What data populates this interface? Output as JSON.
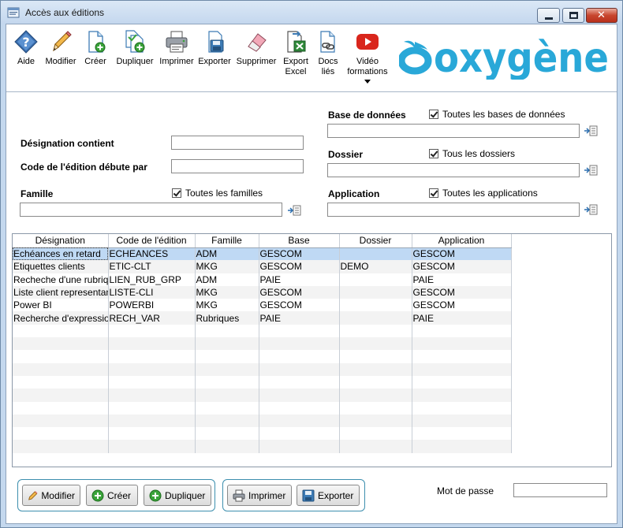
{
  "window": {
    "title": "Accès aux éditions"
  },
  "toolbar": {
    "aide": "Aide",
    "modifier": "Modifier",
    "creer": "Créer",
    "dupliquer": "Dupliquer",
    "imprimer": "Imprimer",
    "exporter": "Exporter",
    "supprimer": "Supprimer",
    "export_excel_1": "Export",
    "export_excel_2": "Excel",
    "docs_lies_1": "Docs",
    "docs_lies_2": "liés",
    "video_1": "Vidéo",
    "video_2": "formations"
  },
  "logo": {
    "text": "oxygène",
    "color": "#29a8d8"
  },
  "filters": {
    "designation_label": "Désignation contient",
    "designation_value": "",
    "code_label": "Code de l'édition débute par",
    "code_value": "",
    "famille_label": "Famille",
    "famille_all": "Toutes les familles",
    "famille_value": "",
    "base_label": "Base de données",
    "base_all": "Toutes les bases de données",
    "base_value": "",
    "dossier_label": "Dossier",
    "dossier_all": "Tous les dossiers",
    "dossier_value": "",
    "application_label": "Application",
    "application_all": "Toutes les applications",
    "application_value": ""
  },
  "grid": {
    "columns": [
      "Désignation",
      "Code de l'édition",
      "Famille",
      "Base",
      "Dossier",
      "Application"
    ],
    "rows": [
      [
        "Echéances en retard",
        "ECHEANCES",
        "ADM",
        "GESCOM",
        "",
        "GESCOM"
      ],
      [
        "Etiquettes clients",
        "ETIC-CLT",
        "MKG",
        "GESCOM",
        "DEMO",
        "GESCOM"
      ],
      [
        "Recheche d'une rubrique",
        "LIEN_RUB_GRP",
        "ADM",
        "PAIE",
        "",
        "PAIE"
      ],
      [
        "Liste client representant",
        "LISTE-CLI",
        "MKG",
        "GESCOM",
        "",
        "GESCOM"
      ],
      [
        "Power BI",
        "POWERBI",
        "MKG",
        "GESCOM",
        "",
        "GESCOM"
      ],
      [
        "Recherche d'expression",
        "RECH_VAR",
        "Rubriques",
        "PAIE",
        "",
        "PAIE"
      ]
    ],
    "selected_row": 0
  },
  "bottom": {
    "modifier": "Modifier",
    "creer": "Créer",
    "dupliquer": "Dupliquer",
    "imprimer": "Imprimer",
    "exporter": "Exporter",
    "password_label": "Mot de passe",
    "password_value": ""
  },
  "colors": {
    "accent": "#3d8fae",
    "selection": "#bfd9f4",
    "video": "#d9261c",
    "green": "#3aa33a"
  }
}
